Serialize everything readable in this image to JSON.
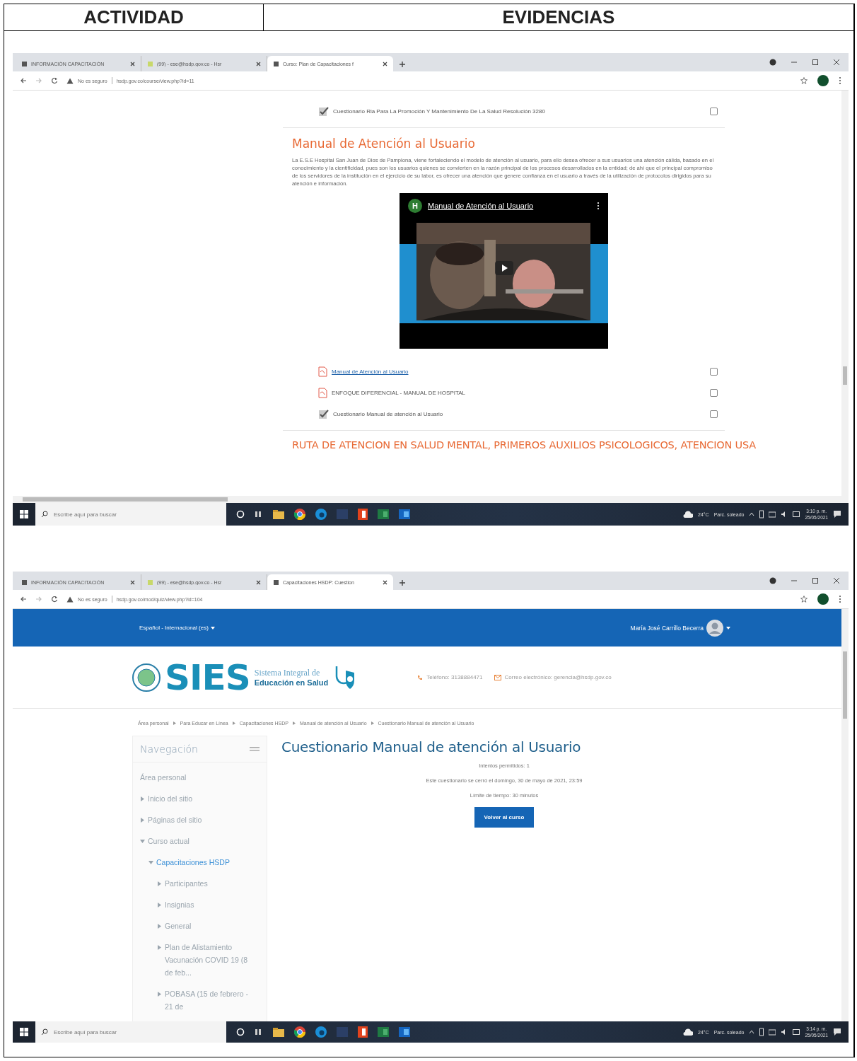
{
  "table": {
    "columns": [
      "ACTIVIDAD",
      "EVIDENCIAS"
    ]
  },
  "screenshots": [
    {
      "kind": "course",
      "browser": {
        "tabs": [
          {
            "title": "INFORMACIÓN CAPACITACIÓN",
            "selected": false
          },
          {
            "title": "(99) - ese@hsdp.gov.co - Hsr",
            "selected": false
          },
          {
            "title": "Curso: Plan de Capacitaciones f",
            "selected": true
          }
        ],
        "security": "No es seguro",
        "url": "hsdp.gov.co/course/view.php?id=11"
      },
      "page": {
        "items_before": [
          {
            "kind": "quiz",
            "title": "Cuestionario Ria Para La Promoción Y Mantenimiento De La Salud Resolución 3280",
            "link": false,
            "completed": false
          }
        ],
        "section": {
          "title": "Manual de Atención al Usuario",
          "text": "La E.S.E Hospital San Juan de Dios de Pamplona, viene fortaleciendo el modelo de atención al usuario, para ello desea ofrecer a sus usuarios una atención cálida, basado en el conocimiento y la cientificidad, pues son los usuarios quienes se convierten en la razón principal de los procesos desarrollados en la entidad; de ahí que el principal compromiso de los servidores de la institución en el ejercicio de su labor, es ofrecer una atención que genere confianza en el usuario a través de la utilización de protocolos dirigidos para su atención e información.",
          "video": {
            "channel_initial": "H",
            "title": "Manual de Atención al Usuario"
          }
        },
        "items": [
          {
            "kind": "pdf",
            "title": "Manual de Atención al Usuario",
            "link": true,
            "completed": false
          },
          {
            "kind": "pdf",
            "title": "ENFOQUE DIFERENCIAL - MANUAL DE HOSPITAL",
            "link": false,
            "completed": false
          },
          {
            "kind": "quiz",
            "title": "Cuestionario Manual de atención al Usuario",
            "link": false,
            "completed": false
          }
        ],
        "next_section": {
          "title": "RUTA DE ATENCION EN SALUD MENTAL, PRIMEROS AUXILIOS PSICOLOGICOS, ATENCION USA"
        }
      },
      "taskbar": {
        "search_placeholder": "Escribe aquí para buscar",
        "temperature": "24°C",
        "weather": "Parc. soleado",
        "time": "3:10 p. m.",
        "date": "25/05/2021"
      }
    },
    {
      "kind": "quiz",
      "browser": {
        "tabs": [
          {
            "title": "INFORMACIÓN CAPACITACIÓN",
            "selected": false
          },
          {
            "title": "(99) - ese@hsdp.gov.co - Hsr",
            "selected": false
          },
          {
            "title": "Capacitaciones HSDP: Cuestion",
            "selected": true
          }
        ],
        "security": "No es seguro",
        "url": "hsdp.gov.co/mod/quiz/view.php?id=104"
      },
      "page": {
        "language": "Español - Internacional (es)",
        "user": "María José Carrillo Becerra",
        "brand": {
          "logo": "SIES",
          "line1": "Sistema Integral de",
          "line2": "Educación en Salud"
        },
        "phone": "Teléfono: 3138884471",
        "email": "Correo electrónico: gerencia@hsdp.gov.co",
        "breadcrumb": [
          "Área personal",
          "Para Educar en Línea",
          "Capacitaciones HSDP",
          "Manual de atención al Usuario",
          "Cuestionario Manual de atención al Usuario"
        ],
        "navigation": {
          "title": "Navegación",
          "items": [
            {
              "label": "Área personal",
              "selected": false
            },
            {
              "label": "Inicio del sitio",
              "selected": false,
              "expanded": false
            },
            {
              "label": "Páginas del sitio",
              "selected": false,
              "expanded": false
            },
            {
              "label": "Curso actual",
              "selected": false,
              "expanded": true,
              "children": [
                {
                  "label": "Capacitaciones HSDP",
                  "selected": true,
                  "expanded": true,
                  "children": [
                    {
                      "label": "Participantes",
                      "selected": false,
                      "expanded": false
                    },
                    {
                      "label": "Insignias",
                      "selected": false,
                      "expanded": false
                    },
                    {
                      "label": "General",
                      "selected": false,
                      "expanded": false
                    },
                    {
                      "label": "Plan de Alistamiento Vacunación COVID 19 (8 de feb...",
                      "selected": false,
                      "expanded": false
                    },
                    {
                      "label": "POBASA (15 de febrero - 21 de",
                      "selected": false,
                      "expanded": false
                    }
                  ]
                }
              ]
            }
          ]
        },
        "title": "Cuestionario Manual de atención al Usuario",
        "info": [
          "Intentos permitidos: 1",
          "Este cuestionario se cerró el domingo, 30 de mayo de 2021, 23:59",
          "Límite de tiempo: 30 minutos"
        ],
        "button": "Volver al curso"
      },
      "taskbar": {
        "search_placeholder": "Escribe aquí para buscar",
        "temperature": "24°C",
        "weather": "Parc. soleado",
        "time": "3:14 p. m.",
        "date": "25/05/2021"
      }
    }
  ]
}
